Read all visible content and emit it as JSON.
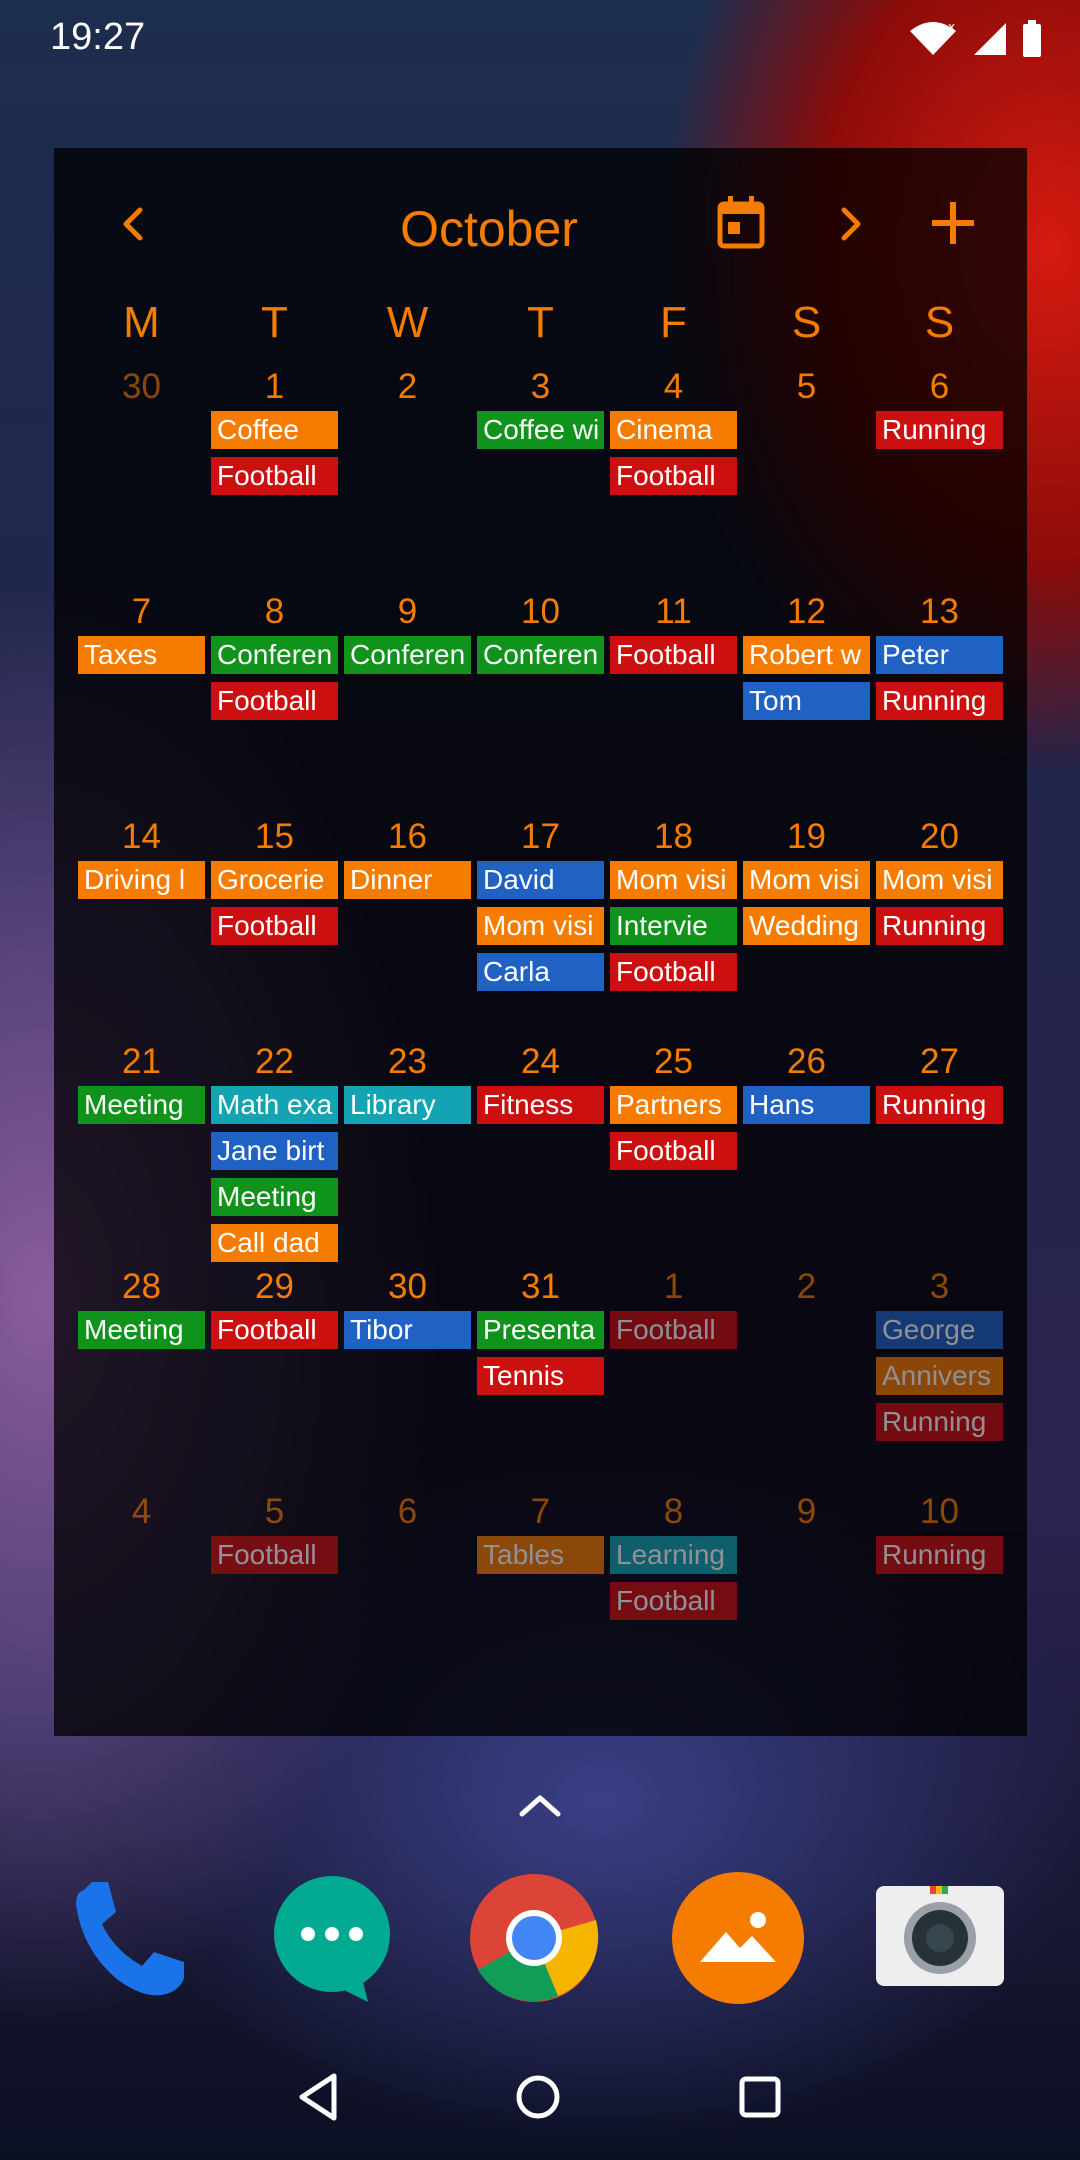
{
  "status": {
    "time": "19:27"
  },
  "calendar": {
    "month": "October",
    "weekdays": [
      "M",
      "T",
      "W",
      "T",
      "F",
      "S",
      "S"
    ],
    "colors": {
      "orange": "#f57c00",
      "red": "#cc0f0f",
      "green": "#10931a",
      "blue": "#1f62c4",
      "teal": "#14a3b3"
    },
    "weeks": [
      [
        {
          "day": "30",
          "dim": true,
          "events": []
        },
        {
          "day": "1",
          "events": [
            {
              "title": "Coffee",
              "color": "orange"
            },
            {
              "title": "Football",
              "color": "red"
            }
          ]
        },
        {
          "day": "2",
          "events": []
        },
        {
          "day": "3",
          "events": [
            {
              "title": "Coffee wi",
              "color": "green"
            }
          ]
        },
        {
          "day": "4",
          "events": [
            {
              "title": "Cinema",
              "color": "orange"
            },
            {
              "title": "Football",
              "color": "red"
            }
          ]
        },
        {
          "day": "5",
          "events": []
        },
        {
          "day": "6",
          "events": [
            {
              "title": "Running",
              "color": "red"
            }
          ]
        }
      ],
      [
        {
          "day": "7",
          "events": [
            {
              "title": "Taxes",
              "color": "orange"
            }
          ]
        },
        {
          "day": "8",
          "events": [
            {
              "title": "Conferen",
              "color": "green"
            },
            {
              "title": "Football",
              "color": "red"
            }
          ]
        },
        {
          "day": "9",
          "events": [
            {
              "title": "Conferen",
              "color": "green"
            }
          ]
        },
        {
          "day": "10",
          "events": [
            {
              "title": "Conferen",
              "color": "green"
            }
          ]
        },
        {
          "day": "11",
          "events": [
            {
              "title": "Football",
              "color": "red"
            }
          ]
        },
        {
          "day": "12",
          "events": [
            {
              "title": "Robert w",
              "color": "orange"
            },
            {
              "title": "Tom",
              "color": "blue"
            }
          ]
        },
        {
          "day": "13",
          "events": [
            {
              "title": "Peter",
              "color": "blue"
            },
            {
              "title": "Running",
              "color": "red"
            }
          ]
        }
      ],
      [
        {
          "day": "14",
          "events": [
            {
              "title": "Driving l",
              "color": "orange"
            }
          ]
        },
        {
          "day": "15",
          "events": [
            {
              "title": "Grocerie",
              "color": "orange"
            },
            {
              "title": "Football",
              "color": "red"
            }
          ]
        },
        {
          "day": "16",
          "events": [
            {
              "title": "Dinner",
              "color": "orange"
            }
          ]
        },
        {
          "day": "17",
          "events": [
            {
              "title": "David",
              "color": "blue"
            },
            {
              "title": "Mom visi",
              "color": "orange"
            },
            {
              "title": "Carla",
              "color": "blue"
            }
          ]
        },
        {
          "day": "18",
          "events": [
            {
              "title": "Mom visi",
              "color": "orange"
            },
            {
              "title": "Intervie",
              "color": "green"
            },
            {
              "title": "Football",
              "color": "red"
            }
          ]
        },
        {
          "day": "19",
          "events": [
            {
              "title": "Mom visi",
              "color": "orange"
            },
            {
              "title": "Wedding",
              "color": "orange"
            }
          ]
        },
        {
          "day": "20",
          "events": [
            {
              "title": "Mom visi",
              "color": "orange"
            },
            {
              "title": "Running",
              "color": "red"
            }
          ]
        }
      ],
      [
        {
          "day": "21",
          "events": [
            {
              "title": "Meeting",
              "color": "green"
            }
          ]
        },
        {
          "day": "22",
          "events": [
            {
              "title": "Math exa",
              "color": "teal"
            },
            {
              "title": "Jane birt",
              "color": "blue"
            },
            {
              "title": "Meeting",
              "color": "green"
            },
            {
              "title": "Call dad",
              "color": "orange"
            }
          ]
        },
        {
          "day": "23",
          "events": [
            {
              "title": "Library",
              "color": "teal"
            }
          ]
        },
        {
          "day": "24",
          "events": [
            {
              "title": "Fitness",
              "color": "red"
            }
          ]
        },
        {
          "day": "25",
          "events": [
            {
              "title": "Partners",
              "color": "orange"
            },
            {
              "title": "Football",
              "color": "red"
            }
          ]
        },
        {
          "day": "26",
          "events": [
            {
              "title": "Hans",
              "color": "blue"
            }
          ]
        },
        {
          "day": "27",
          "events": [
            {
              "title": "Running",
              "color": "red"
            }
          ]
        }
      ],
      [
        {
          "day": "28",
          "events": [
            {
              "title": "Meeting",
              "color": "green"
            }
          ]
        },
        {
          "day": "29",
          "events": [
            {
              "title": "Football",
              "color": "red"
            }
          ]
        },
        {
          "day": "30",
          "events": [
            {
              "title": "Tibor",
              "color": "blue"
            }
          ]
        },
        {
          "day": "31",
          "events": [
            {
              "title": "Presenta",
              "color": "green"
            },
            {
              "title": "Tennis",
              "color": "red"
            }
          ]
        },
        {
          "day": "1",
          "dim": true,
          "events": [
            {
              "title": "Football",
              "color": "red"
            }
          ]
        },
        {
          "day": "2",
          "dim": true,
          "events": []
        },
        {
          "day": "3",
          "dim": true,
          "events": [
            {
              "title": "George",
              "color": "blue"
            },
            {
              "title": "Annivers",
              "color": "orange"
            },
            {
              "title": "Running",
              "color": "red"
            }
          ]
        }
      ],
      [
        {
          "day": "4",
          "dim": true,
          "events": []
        },
        {
          "day": "5",
          "dim": true,
          "events": [
            {
              "title": "Football",
              "color": "red"
            }
          ]
        },
        {
          "day": "6",
          "dim": true,
          "events": []
        },
        {
          "day": "7",
          "dim": true,
          "events": [
            {
              "title": "Tables",
              "color": "orange"
            }
          ]
        },
        {
          "day": "8",
          "dim": true,
          "events": [
            {
              "title": "Learning",
              "color": "teal"
            },
            {
              "title": "Football",
              "color": "red"
            }
          ]
        },
        {
          "day": "9",
          "dim": true,
          "events": []
        },
        {
          "day": "10",
          "dim": true,
          "events": [
            {
              "title": "Running",
              "color": "red"
            }
          ]
        }
      ]
    ]
  },
  "dock": {
    "apps": [
      {
        "name": "phone-app",
        "icon": "phone-icon"
      },
      {
        "name": "messages-app",
        "icon": "messages-icon"
      },
      {
        "name": "chrome-app",
        "icon": "chrome-icon"
      },
      {
        "name": "gallery-app",
        "icon": "gallery-icon"
      },
      {
        "name": "camera-app",
        "icon": "camera-icon"
      }
    ]
  }
}
